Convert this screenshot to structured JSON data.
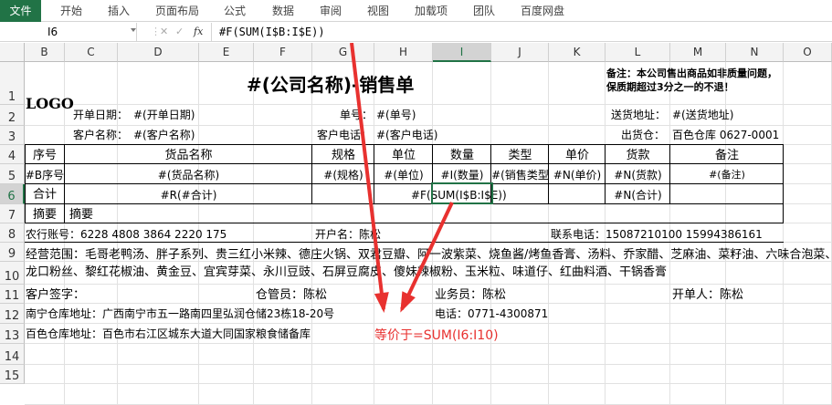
{
  "ribbon": {
    "file": "文件",
    "tabs": [
      "开始",
      "插入",
      "页面布局",
      "公式",
      "数据",
      "审阅",
      "视图",
      "加载项",
      "团队",
      "百度网盘"
    ]
  },
  "formula_bar": {
    "name_box": "I6",
    "fx": "fx",
    "formula": "#F(SUM(I$B:I$E))"
  },
  "columns": [
    "B",
    "C",
    "D",
    "E",
    "F",
    "G",
    "H",
    "I",
    "J",
    "K",
    "L",
    "M",
    "N",
    "O"
  ],
  "rows": [
    "1",
    "2",
    "3",
    "4",
    "5",
    "6",
    "7",
    "8",
    "9",
    "10",
    "11",
    "12",
    "13",
    "14",
    "15"
  ],
  "sheet": {
    "logo": "LOGO",
    "title": "#(公司名称)-销售单",
    "note": "备注：本公司售出商品如非质量问题，保质期超过3分之一的不退！",
    "r2": {
      "date_label": "开单日期：",
      "date_val": "#(开单日期)",
      "num_label": "单号：",
      "num_val": "#(单号)",
      "addr_label": "送货地址：",
      "addr_val": "#(送货地址)"
    },
    "r3": {
      "cust_label": "客户名称：",
      "cust_val": "#(客户名称)",
      "phone_label": "客户电话：",
      "phone_val": "#(客户电话)",
      "wh_label": "出货仓：",
      "wh_val": "百色仓库 0627-0001"
    },
    "headers": [
      "序号",
      "货品名称",
      "规格",
      "单位",
      "数量",
      "类型",
      "单价",
      "货款",
      "备注"
    ],
    "r5": [
      "#B序号",
      "#(货品名称)",
      "#(规格)",
      "#(单位)",
      "#I(数量)",
      "#(销售类型",
      "#N(单价)",
      "#N(货款)",
      "#(备注)"
    ],
    "r6": {
      "total": "合计",
      "total_val": "#R(#合计)",
      "qty_sum": "#F(SUM(I$B:I$E))",
      "amount": "#N(合计)"
    },
    "r7": {
      "label": "摘要",
      "val": "摘要"
    },
    "r8": {
      "bank": "农行账号：6228 4808 3864 2220 175",
      "holder": "开户名：陈松",
      "tel": "联系电话：15087210100  15994386161"
    },
    "r9": "经营范围：毛哥老鸭汤、胖子系列、贵三红小米辣、德庄火锅、双君豆瓣、阿一波紫菜、烧鱼酱/烤鱼香膏、汤料、乔家醋、芝麻油、菜籽油、六味合泡菜、",
    "r10": "龙口粉丝、黎红花椒油、黄金豆、宜宾芽菜、永川豆豉、石屏豆腐皮、傻妹辣椒粉、玉米粒、味道仔、红曲料酒、干锅香膏",
    "r11": {
      "cust_sign": "客户签字：",
      "wh_clerk": "仓管员：陈松",
      "sales": "业务员：陈松",
      "issuer": "开单人：陈松"
    },
    "r12": {
      "nn_addr": "南宁仓库地址：广西南宁市五一路南四里弘润仓储23栋18-20号",
      "phone": "电话：0771-4300871"
    },
    "r13": {
      "bs_addr": "百色仓库地址：百色市右江区城东大道大同国家粮食储备库"
    }
  },
  "annotation": "等价于=SUM(I6:I10)",
  "colors": {
    "accent": "#217346",
    "annotation": "#e8312f"
  }
}
